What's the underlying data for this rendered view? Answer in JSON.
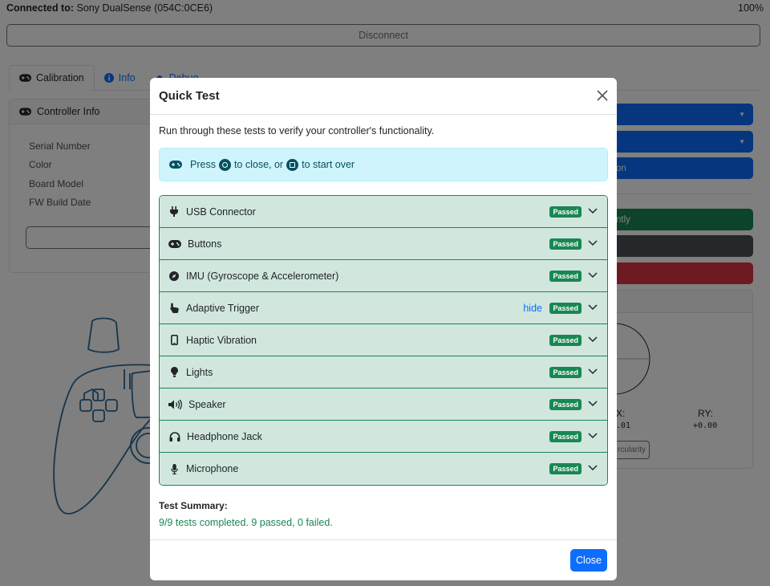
{
  "topbar": {
    "connected_label": "Connected to:",
    "device_name": "Sony DualSense (054C:0CE6)",
    "battery": "100%"
  },
  "disconnect_label": "Disconnect",
  "tabs": [
    {
      "label": "Calibration",
      "icon": "gamepad-icon"
    },
    {
      "label": "Info",
      "icon": "info-icon"
    },
    {
      "label": "Debug",
      "icon": "bug-icon"
    }
  ],
  "controller_info": {
    "title": "Controller Info",
    "rows": [
      "Serial Number",
      "Color",
      "Board Model",
      "FW Build Date"
    ]
  },
  "right_panel": {
    "partial_btn_3": "on",
    "partial_btn_4": "ntly",
    "stick_labels": {
      "lx_partial": "X:",
      "ry": "RY:"
    },
    "stick_values": {
      "lx_partial": ".01",
      "ry": "+0.00"
    },
    "circularity_partial": "rcularity",
    "colors": {
      "primary": "#0d6efd",
      "success": "#198754",
      "secondary": "#495057",
      "danger": "#dc3545"
    }
  },
  "modal": {
    "title": "Quick Test",
    "description": "Run through these tests to verify your controller's functionality.",
    "alert": {
      "press": "Press",
      "to_close": "to close, or",
      "to_start": "to start over"
    },
    "tests": [
      {
        "label": "USB Connector",
        "icon": "plug-icon",
        "status": "Passed"
      },
      {
        "label": "Buttons",
        "icon": "gamepad-icon",
        "status": "Passed"
      },
      {
        "label": "IMU (Gyroscope & Accelerometer)",
        "icon": "compass-icon",
        "status": "Passed"
      },
      {
        "label": "Adaptive Trigger",
        "icon": "pointer-hand-icon",
        "status": "Passed",
        "action": "hide"
      },
      {
        "label": "Haptic Vibration",
        "icon": "mobile-icon",
        "status": "Passed"
      },
      {
        "label": "Lights",
        "icon": "lightbulb-icon",
        "status": "Passed"
      },
      {
        "label": "Speaker",
        "icon": "speaker-icon",
        "status": "Passed"
      },
      {
        "label": "Headphone Jack",
        "icon": "headphones-icon",
        "status": "Passed"
      },
      {
        "label": "Microphone",
        "icon": "microphone-icon",
        "status": "Passed"
      }
    ],
    "summary_title": "Test Summary:",
    "summary_text": "9/9 tests completed. 9 passed, 0 failed.",
    "close_label": "Close"
  }
}
